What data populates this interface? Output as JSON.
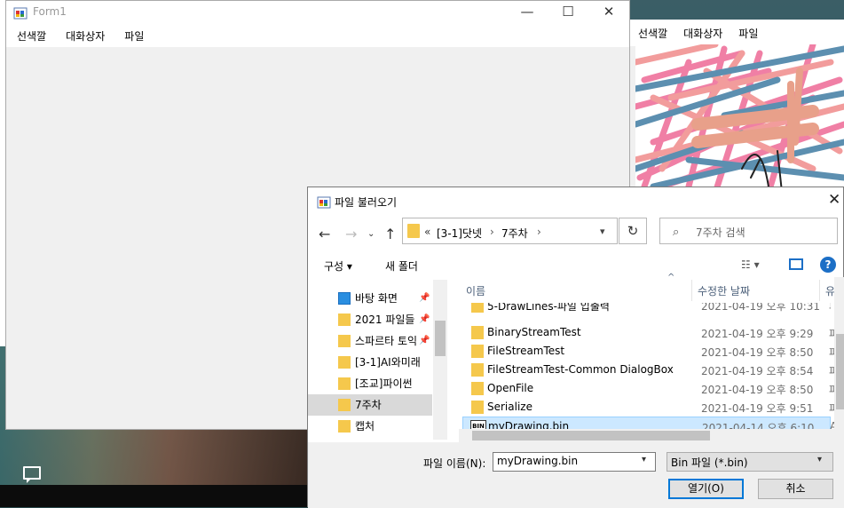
{
  "background_form": {
    "menu": [
      "선색깔",
      "대화상자",
      "파일"
    ]
  },
  "form1": {
    "title": "Form1",
    "menu": [
      "선색깔",
      "대화상자",
      "파일"
    ],
    "minimize_glyph": "—",
    "maximize_glyph": "☐",
    "close_glyph": "✕"
  },
  "dialog": {
    "title": "파일 불러오기",
    "close_glyph": "✕",
    "address": {
      "prefix": "«",
      "segments": [
        "[3-1]닷넷",
        "7주차"
      ],
      "separator": "›"
    },
    "search_placeholder": "7주차 검색",
    "toolbar": {
      "organize": "구성 ▾",
      "new_folder": "새 폴더"
    },
    "nav_items": [
      {
        "label": "바탕 화면",
        "pinned": true,
        "icon": "desktop-icon"
      },
      {
        "label": "2021 파일들",
        "pinned": true,
        "icon": "folder-icon"
      },
      {
        "label": "스파르타 토익",
        "pinned": true,
        "icon": "folder-icon"
      },
      {
        "label": "[3-1]AI와미래",
        "pinned": false,
        "icon": "folder-icon"
      },
      {
        "label": "[조교]파이썬",
        "pinned": false,
        "icon": "folder-icon"
      },
      {
        "label": "7주차",
        "pinned": false,
        "icon": "folder-icon",
        "selected": true
      },
      {
        "label": "캡처",
        "pinned": false,
        "icon": "folder-icon"
      }
    ],
    "columns": {
      "name": "이름",
      "date": "수정한 날짜",
      "type": "유"
    },
    "files": [
      {
        "name": "5-DrawLines-파일 입출력",
        "date": "2021-04-19 오후 10:31",
        "type": "파",
        "icon": "folder-icon"
      },
      {
        "name": "BinaryStreamTest",
        "date": "2021-04-19 오후 9:29",
        "type": "파",
        "icon": "folder-icon"
      },
      {
        "name": "FileStreamTest",
        "date": "2021-04-19 오후 8:50",
        "type": "파",
        "icon": "folder-icon"
      },
      {
        "name": "FileStreamTest-Common DialogBox",
        "date": "2021-04-19 오후 8:54",
        "type": "파",
        "icon": "folder-icon"
      },
      {
        "name": "OpenFile",
        "date": "2021-04-19 오후 8:50",
        "type": "파",
        "icon": "folder-icon"
      },
      {
        "name": "Serialize",
        "date": "2021-04-19 오후 9:51",
        "type": "파",
        "icon": "folder-icon"
      },
      {
        "name": "myDrawing.bin",
        "date": "2021-04-14 오후 6:10",
        "type": "AI",
        "icon": "bin-file-icon",
        "selected": true
      }
    ],
    "filename_label": "파일 이름(N):",
    "filename_value": "myDrawing.bin",
    "filetype_value": "Bin 파일 (*.bin)",
    "open_button": "열기(O)",
    "cancel_button": "취소"
  }
}
